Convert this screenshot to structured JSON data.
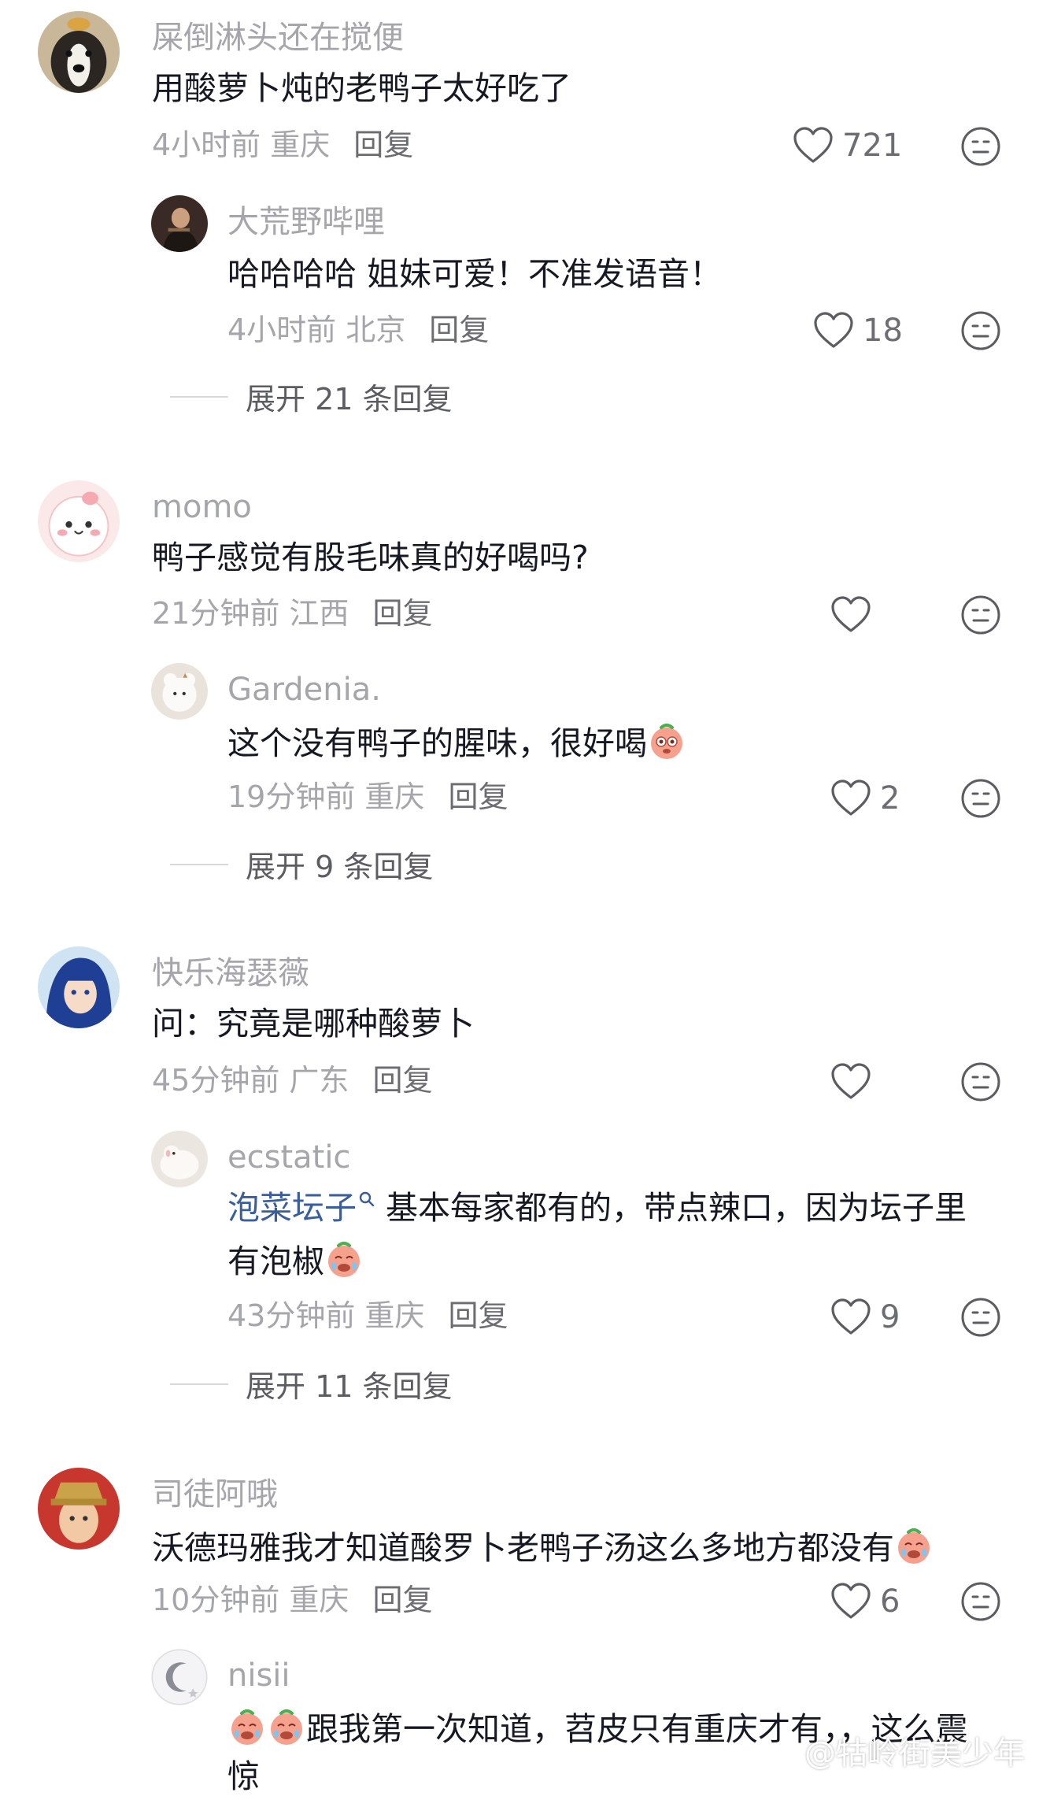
{
  "comments": [
    {
      "user": "屎倒淋头还在搅便",
      "text": "用酸萝卜炖的老鸭子太好吃了",
      "time": "4小时前 重庆",
      "reply": "回复",
      "likes": "721",
      "replies": [
        {
          "user": "大荒野哔哩",
          "text": "哈哈哈哈 姐妹可爱！不准发语音！",
          "time": "4小时前 北京",
          "reply": "回复",
          "likes": "18"
        }
      ],
      "expand": "展开 21 条回复"
    },
    {
      "user": "momo",
      "text": "鸭子感觉有股毛味真的好喝吗?",
      "time": "21分钟前 江西",
      "reply": "回复",
      "likes": "",
      "replies": [
        {
          "user": "Gardenia.",
          "text": "这个没有鸭子的腥味，很好喝",
          "time": "19分钟前 重庆",
          "reply": "回复",
          "likes": "2"
        }
      ],
      "expand": "展开 9 条回复"
    },
    {
      "user": "快乐海瑟薇",
      "text": "问：究竟是哪种酸萝卜",
      "time": "45分钟前 广东",
      "reply": "回复",
      "likes": "",
      "replies": [
        {
          "user": "ecstatic",
          "link": "泡菜坛子",
          "text": " 基本每家都有的，带点辣口，因为坛子里",
          "text2": "有泡椒",
          "time": "43分钟前 重庆",
          "reply": "回复",
          "likes": "9"
        }
      ],
      "expand": "展开 11 条回复"
    },
    {
      "user": "司徒阿哦",
      "text": "沃德玛雅我才知道酸罗卜老鸭子汤这么多地方都没有",
      "time": "10分钟前 重庆",
      "reply": "回复",
      "likes": "6",
      "replies": [
        {
          "user": "nisii",
          "text": "跟我第一次知道，苕皮只有重庆才有，，这么震",
          "text2": "惊"
        }
      ]
    }
  ],
  "icons": {
    "like": "heart-outline-icon",
    "dislike": "meh-face-icon",
    "search": "search-icon"
  },
  "watermark": "@牯岭街美少年"
}
